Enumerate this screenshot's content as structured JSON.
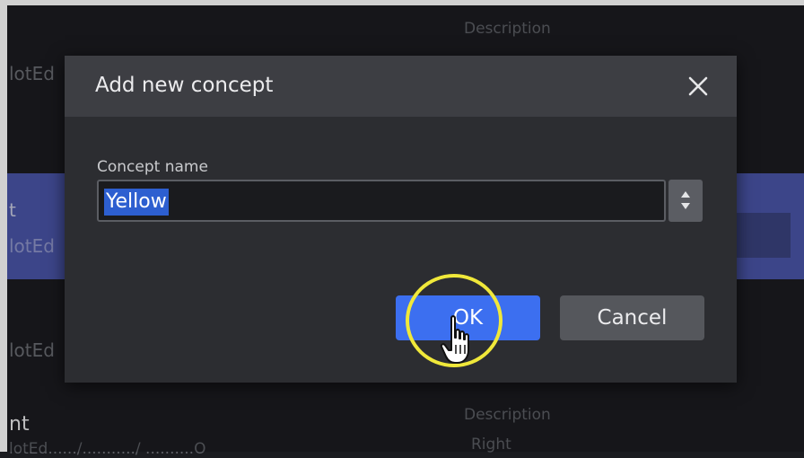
{
  "background": {
    "header_text": "Description",
    "row1_text": "lotEd",
    "row2_text_top": "t",
    "row2_text": "lotEd",
    "row3_text": "lotEd",
    "bottom_heading": "nt",
    "bottom_desc": "Description",
    "bottom_right": "Right",
    "bottom_path": "lotEd....../.........../ ..........O"
  },
  "dialog": {
    "title": "Add new concept",
    "field_label": "Concept name",
    "field_value": "Yellow",
    "ok_label": "OK",
    "cancel_label": "Cancel"
  },
  "colors": {
    "accent": "#3c6ff0",
    "selection": "#2d5fd0",
    "highlight_ring": "#f0e83a",
    "selected_row": "#4a55a8"
  },
  "icons": {
    "close": "close-icon",
    "spinner_up": "chevron-up-icon",
    "spinner_down": "chevron-down-icon",
    "cursor": "hand-pointer-icon"
  }
}
